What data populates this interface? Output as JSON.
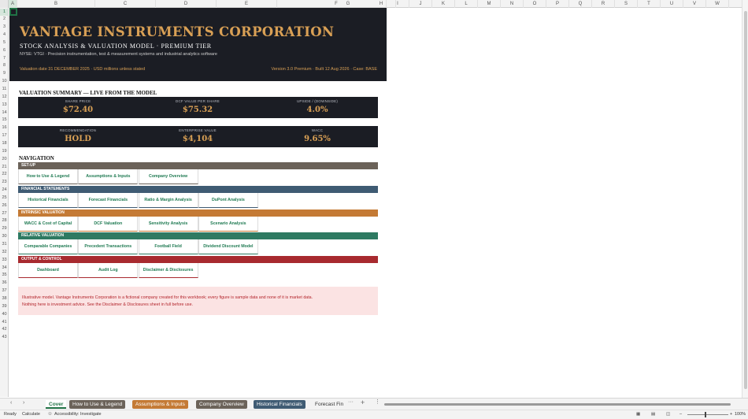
{
  "columns": [
    "A",
    "B",
    "C",
    "D",
    "E",
    "F",
    "G",
    "H",
    "I",
    "J",
    "K",
    "L",
    "M",
    "N",
    "O",
    "P",
    "Q",
    "R",
    "S",
    "T",
    "U",
    "V",
    "W"
  ],
  "rows": [
    "1",
    "2",
    "3",
    "4",
    "5",
    "6",
    "7",
    "8",
    "9",
    "10",
    "11",
    "12",
    "13",
    "14",
    "15",
    "16",
    "17",
    "18",
    "19",
    "20",
    "21",
    "22",
    "23",
    "24",
    "25",
    "26",
    "27",
    "28",
    "29",
    "30",
    "31",
    "32",
    "33",
    "34",
    "35",
    "36",
    "37",
    "38",
    "39",
    "40",
    "41",
    "42",
    "43"
  ],
  "banner": {
    "title": "VANTAGE INSTRUMENTS CORPORATION",
    "subtitle": "STOCK ANALYSIS & VALUATION MODEL  ·  PREMIUM TIER",
    "description": "NYSE: VTGI  ·  Precision instrumentation, test & measurement systems and industrial analytics software",
    "valuation_date": "Valuation date  31 DECEMBER 2025   ·  USD millions unless stated",
    "version": "Version 3.0 Premium  ·  Built 12 Aug 2026  ·  Case: BASE"
  },
  "summary": {
    "title": "VALUATION SUMMARY  —  LIVE FROM THE MODEL",
    "row1": [
      {
        "label": "SHARE PRICE",
        "value": "$72.40"
      },
      {
        "label": "DCF VALUE PER SHARE",
        "value": "$75.32"
      },
      {
        "label": "UPSIDE / (DOWNSIDE)",
        "value": "4.0%"
      }
    ],
    "row2": [
      {
        "label": "RECOMMENDATION",
        "value": "HOLD"
      },
      {
        "label": "ENTERPRISE VALUE",
        "value": "$4,104"
      },
      {
        "label": "WACC",
        "value": "9.65%"
      }
    ]
  },
  "navigation": {
    "title": "NAVIGATION",
    "sections": [
      {
        "label": "SET-UP",
        "color": "#6b6259",
        "buttons": [
          "How to Use & Legend",
          "Assumptions & Inputs",
          "Company Overview"
        ]
      },
      {
        "label": "FINANCIAL STATEMENTS",
        "color": "#3f5b73",
        "buttons": [
          "Historical Financials",
          "Forecast Financials",
          "Ratio & Margin Analysis",
          "DuPont Analysis"
        ]
      },
      {
        "label": "INTRINSIC VALUATION",
        "color": "#c47a35",
        "buttons": [
          "WACC & Cost of Capital",
          "DCF Valuation",
          "Sensitivity Analysis",
          "Scenario Analysis"
        ]
      },
      {
        "label": "RELATIVE VALUATION",
        "color": "#2e7a62",
        "buttons": [
          "Comparable Companies",
          "Precedent Transactions",
          "Football Field",
          "Dividend Discount Model"
        ]
      },
      {
        "label": "OUTPUT & CONTROL",
        "color": "#a82a2f",
        "buttons": [
          "Dashboard",
          "Audit Log",
          "Disclaimer & Disclosures"
        ]
      }
    ]
  },
  "disclaimer": {
    "line1": "Illustrative model. Vantage Instruments Corporation is a fictional company created for this workbook; every figure is sample data and none of it is market data.",
    "line2": "Nothing here is investment advice. See the Disclaimer & Disclosures sheet in full before use."
  },
  "tabs": [
    {
      "label": "Cover",
      "active": true,
      "color": ""
    },
    {
      "label": "How to Use & Legend",
      "color": "#6b6259"
    },
    {
      "label": "Assumptions & Inputs",
      "color": "#c47a35"
    },
    {
      "label": "Company Overview",
      "color": "#6b6259"
    },
    {
      "label": "Historical Financials",
      "color": "#3f5b73"
    },
    {
      "label": "Forecast Fin",
      "color": ""
    }
  ],
  "tab_more": "···",
  "tab_add": "+",
  "status": {
    "ready": "Ready",
    "calculate": "Calculate",
    "accessibility": "Accessibility: Investigate",
    "zoom": "100%"
  }
}
